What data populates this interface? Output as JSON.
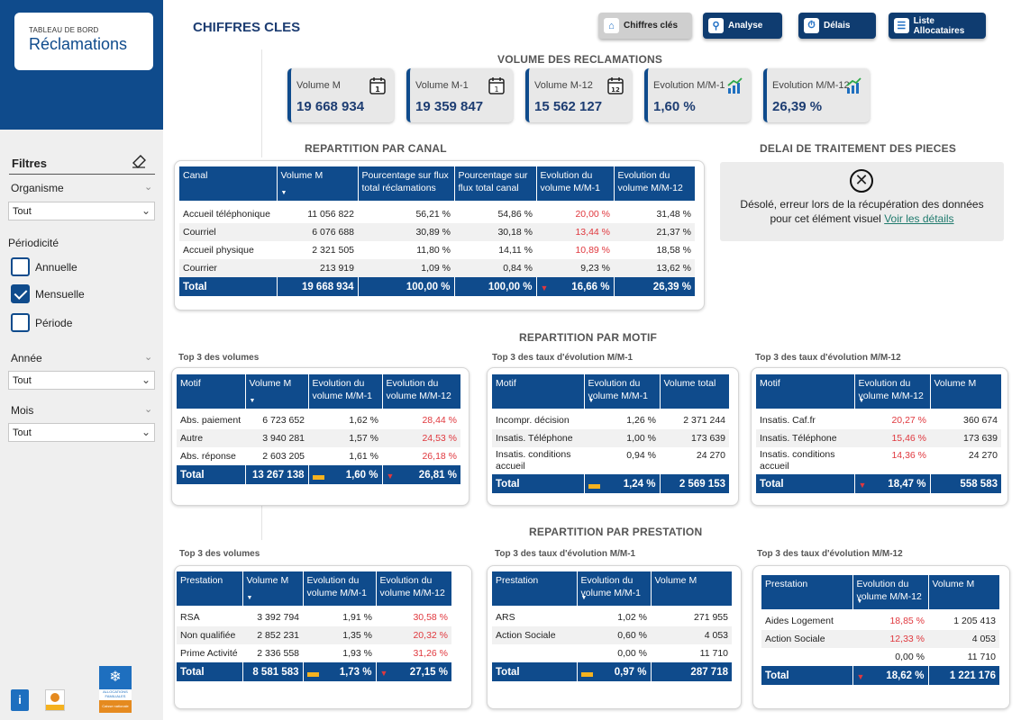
{
  "logo": {
    "line1": "TABLEAU DE BORD",
    "line2": "Réclamations"
  },
  "sidebar": {
    "filters_title": "Filtres",
    "organisme": {
      "label": "Organisme",
      "value": "Tout"
    },
    "periodicite": {
      "label": "Périodicité",
      "options": [
        {
          "label": "Annuelle",
          "checked": false
        },
        {
          "label": "Mensuelle",
          "checked": true
        },
        {
          "label": "Période",
          "checked": false
        }
      ]
    },
    "annee": {
      "label": "Année",
      "value": "Tout"
    },
    "mois": {
      "label": "Mois",
      "value": "Tout"
    }
  },
  "header": {
    "title": "CHIFFRES CLES"
  },
  "nav": [
    {
      "label": "Chiffres clés",
      "icon": "home-icon",
      "active": true
    },
    {
      "label": "Analyse",
      "icon": "magnifier-icon",
      "active": false
    },
    {
      "label": "Délais",
      "icon": "stopwatch-icon",
      "active": false
    },
    {
      "label": "Liste Allocataires",
      "icon": "list-icon",
      "active": false
    }
  ],
  "volume": {
    "title": "VOLUME DES RECLAMATIONS",
    "kpis": [
      {
        "label": "Volume M",
        "value": "19 668 934",
        "icon": "calendar-icon"
      },
      {
        "label": "Volume M-1",
        "value": "19 359 847",
        "icon": "calendar-icon"
      },
      {
        "label": "Volume M-12",
        "value": "15 562 127",
        "icon": "calendar-icon"
      },
      {
        "label": "Evolution M/M-1",
        "value": "1,60 %",
        "icon": "trend-chart-icon"
      },
      {
        "label": "Evolution M/M-12",
        "value": "26,39 %",
        "icon": "trend-chart-icon"
      }
    ]
  },
  "canal": {
    "title": "REPARTITION PAR CANAL",
    "headers": [
      "Canal",
      "Volume M",
      "Pourcentage sur flux total réclamations",
      "Pourcentage sur flux total canal",
      "Evolution du volume M/M-1",
      "Evolution du volume M/M-12"
    ],
    "rows": [
      [
        "Accueil téléphonique",
        "11 056 822",
        "56,21 %",
        "54,86 %",
        "20,00 %",
        "31,48 %"
      ],
      [
        "Courriel",
        "6 076 688",
        "30,89 %",
        "30,18 %",
        "13,44 %",
        "21,37 %"
      ],
      [
        "Accueil physique",
        "2 321 505",
        "11,80 %",
        "14,11 %",
        "10,89 %",
        "18,58 %"
      ],
      [
        "Courrier",
        "213 919",
        "1,09 %",
        "0,84 %",
        "9,23 %",
        "13,62 %"
      ]
    ],
    "total": [
      "Total",
      "19 668 934",
      "100,00 %",
      "100,00 %",
      "16,66 %",
      "26,39 %"
    ]
  },
  "delai": {
    "title": "DELAI DE TRAITEMENT DES PIECES",
    "error_line1": "Désolé, erreur lors de la récupération des données",
    "error_line2": "pour cet élément visuel",
    "link": "Voir les détails"
  },
  "motif": {
    "title": "REPARTITION PAR MOTIF",
    "vol": {
      "subtitle": "Top 3 des volumes",
      "headers": [
        "Motif",
        "Volume M",
        "Evolution du volume M/M-1",
        "Evolution du volume M/M-12"
      ],
      "rows": [
        [
          "Abs. paiement",
          "6 723 652",
          "1,62 %",
          "28,44 %"
        ],
        [
          "Autre",
          "3 940 281",
          "1,57 %",
          "24,53 %"
        ],
        [
          "Abs. réponse",
          "2 603 205",
          "1,61 %",
          "26,18 %"
        ]
      ],
      "total": [
        "Total",
        "13 267 138",
        "1,60 %",
        "26,81 %"
      ]
    },
    "evo1": {
      "subtitle": "Top 3 des taux d'évolution M/M-1",
      "headers": [
        "Motif",
        "Evolution du volume M/M-1",
        "Volume total"
      ],
      "rows": [
        [
          "Incompr. décision",
          "1,26 %",
          "2 371 244"
        ],
        [
          "Insatis. Téléphone",
          "1,00 %",
          "173 639"
        ],
        [
          "Insatis. conditions accueil",
          "0,94 %",
          "24 270"
        ]
      ],
      "total": [
        "Total",
        "1,24 %",
        "2 569 153"
      ]
    },
    "evo12": {
      "subtitle": "Top 3 des taux d'évolution M/M-12",
      "headers": [
        "Motif",
        "Evolution du volume M/M-12",
        "Volume M"
      ],
      "rows": [
        [
          "Insatis. Caf.fr",
          "20,27 %",
          "360 674"
        ],
        [
          "Insatis. Téléphone",
          "15,46 %",
          "173 639"
        ],
        [
          "Insatis. conditions accueil",
          "14,36 %",
          "24 270"
        ]
      ],
      "total": [
        "Total",
        "18,47 %",
        "558 583"
      ]
    }
  },
  "prestation": {
    "title": "REPARTITION PAR PRESTATION",
    "vol": {
      "subtitle": "Top 3 des volumes",
      "headers": [
        "Prestation",
        "Volume M",
        "Evolution du volume M/M-1",
        "Evolution du volume M/M-12"
      ],
      "rows": [
        [
          "RSA",
          "3 392 794",
          "1,91 %",
          "30,58 %"
        ],
        [
          "Non qualifiée",
          "2 852 231",
          "1,35 %",
          "20,32 %"
        ],
        [
          "Prime Activité",
          "2 336 558",
          "1,93 %",
          "31,26 %"
        ]
      ],
      "total": [
        "Total",
        "8 581 583",
        "1,73 %",
        "27,15 %"
      ]
    },
    "evo1": {
      "subtitle": "Top 3 des taux d'évolution M/M-1",
      "headers": [
        "Prestation",
        "Evolution du volume M/M-1",
        "Volume M"
      ],
      "rows": [
        [
          "ARS",
          "1,02 %",
          "271 955"
        ],
        [
          "Action Sociale",
          "0,60 %",
          "4 053"
        ],
        [
          "",
          "0,00 %",
          "11 710"
        ]
      ],
      "total": [
        "Total",
        "0,97 %",
        "287 718"
      ]
    },
    "evo12": {
      "subtitle": "Top 3 des taux d'évolution M/M-12",
      "headers": [
        "Prestation",
        "Evolution du volume M/M-12",
        "Volume M"
      ],
      "rows": [
        [
          "Aides Logement",
          "18,85 %",
          "1 205 413"
        ],
        [
          "Action Sociale",
          "12,33 %",
          "4 053"
        ],
        [
          "",
          "0,00 %",
          "11 710"
        ]
      ],
      "total": [
        "Total",
        "18,62 %",
        "1 221 176"
      ]
    }
  },
  "footer": {
    "caf_line1": "ALLOCATIONS FAMILIALES",
    "caf_line2": "Caisse nationale"
  },
  "colors": {
    "brand": "#0f4b8c",
    "red": "#e0383e",
    "amber": "#f5b21f"
  }
}
